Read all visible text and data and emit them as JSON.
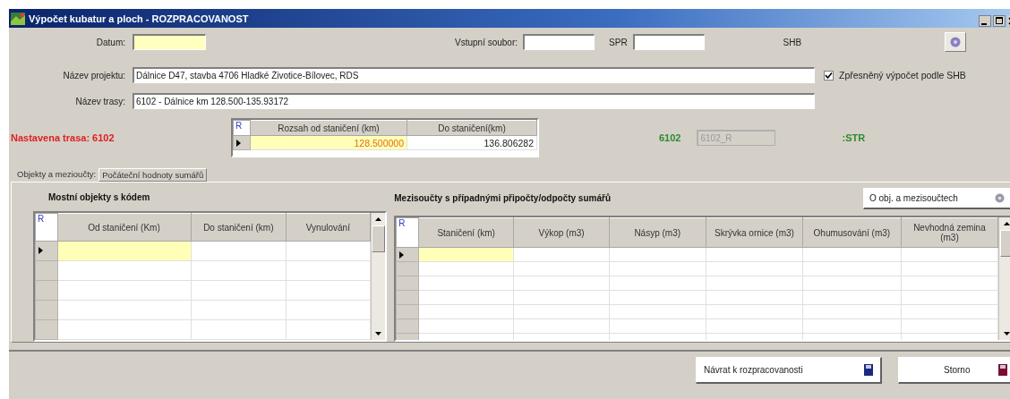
{
  "window": {
    "title": "Výpočet kubatur a ploch - ROZPRACOVANOST"
  },
  "top_row": {
    "date_label": "Datum:",
    "input_file_label": "Vstupní soubor:",
    "spr_label": "SPR",
    "shb_label": "SHB"
  },
  "project": {
    "label": "Název projektu:",
    "value": "Dálnice D47, stavba 4706 Hladké Životice-Bílovec, RDS"
  },
  "route": {
    "label": "Název trasy:",
    "value": "6102 - Dálnice km 128.500-135.93172"
  },
  "refine_checkbox": {
    "label": "Zpřesněný výpočet podle SHB",
    "checked": true
  },
  "set_route": "Nastavena trasa: 6102",
  "range_grid": {
    "corner": "R",
    "columns": [
      "Rozsah od staničení (km)",
      "Do staničení(km)"
    ],
    "rows": [
      {
        "current": true,
        "cells": [
          "128.500000",
          "136.806282"
        ]
      }
    ]
  },
  "route_code": "6102",
  "route_field": {
    "value": "6102_R",
    "disabled": true
  },
  "str_label": ":STR",
  "tabs": [
    {
      "label": "Objekty a mezioučty:",
      "selected": true
    },
    {
      "label": "Počáteční hodnoty sumářů",
      "selected": false
    }
  ],
  "bridges": {
    "title": "Mostní objekty s kódem",
    "corner": "R",
    "columns": [
      "Od staničení (Km)",
      "Do staničení (km)",
      "Vynulování"
    ],
    "rows": [
      {
        "current": true
      },
      {
        "current": false
      },
      {
        "current": false
      },
      {
        "current": false
      },
      {
        "current": false
      }
    ]
  },
  "subtotals": {
    "title": "Mezisoučty s případnými připočty/odpočty sumářů",
    "button": "O obj. a mezisoučtech",
    "corner": "R",
    "columns": [
      "Staničení (km)",
      "Výkop (m3)",
      "Násyp (m3)",
      "Skrývka ornice (m3)",
      "Ohumusování (m3)",
      "Nevhodná zemina (m3)"
    ],
    "rows": [
      {
        "current": true
      },
      {
        "current": false
      },
      {
        "current": false
      },
      {
        "current": false
      },
      {
        "current": false
      },
      {
        "current": false
      },
      {
        "current": false
      }
    ]
  },
  "buttons": [
    {
      "label": "Návrat k rozpracovanosti",
      "kind": "return"
    },
    {
      "label": "Storno",
      "kind": "cancel"
    }
  ]
}
